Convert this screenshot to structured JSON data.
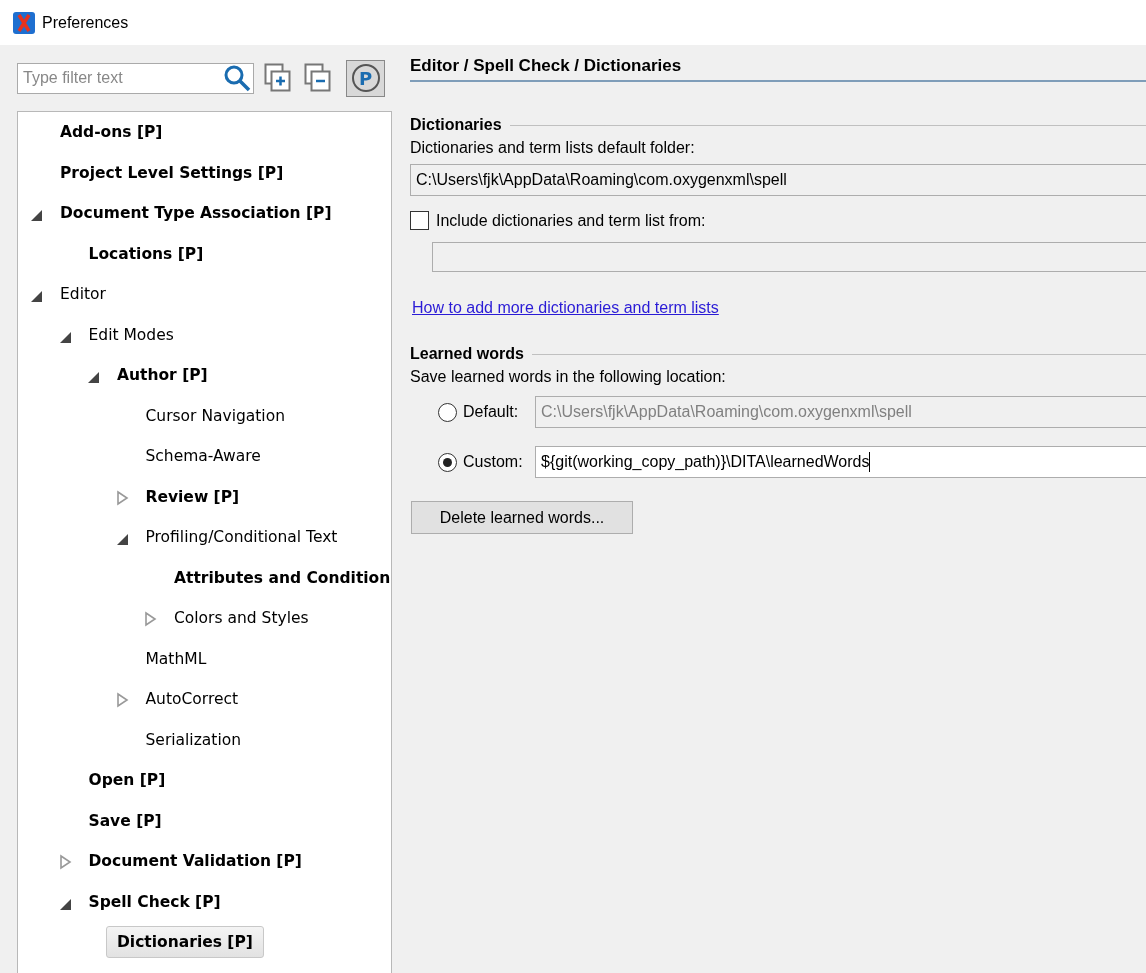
{
  "window": {
    "title": "Preferences"
  },
  "filter": {
    "placeholder": "Type filter text"
  },
  "toolbar": {
    "project_toggle": {
      "label": "P",
      "pressed": true
    }
  },
  "tree": [
    {
      "label": "Add-ons [P]",
      "bold": true,
      "selected": false
    },
    {
      "label": "Project Level Settings [P]",
      "bold": true,
      "selected": false
    },
    {
      "label": "Document Type Association [P]",
      "bold": true,
      "selected": false,
      "expanded": true,
      "children": [
        {
          "label": "Locations [P]",
          "bold": true,
          "selected": false
        }
      ]
    },
    {
      "label": "Editor",
      "bold": false,
      "selected": false,
      "expanded": true,
      "children": [
        {
          "label": "Edit Modes",
          "bold": false,
          "selected": false,
          "expanded": true,
          "children": [
            {
              "label": "Author [P]",
              "bold": true,
              "selected": false,
              "expanded": true,
              "children": [
                {
                  "label": "Cursor Navigation",
                  "bold": false,
                  "selected": false
                },
                {
                  "label": "Schema-Aware",
                  "bold": false,
                  "selected": false
                },
                {
                  "label": "Review [P]",
                  "bold": true,
                  "selected": false,
                  "expanded": false
                },
                {
                  "label": "Profiling/Conditional Text",
                  "bold": false,
                  "selected": false,
                  "expanded": true,
                  "children": [
                    {
                      "label": "Attributes and Condition",
                      "bold": true,
                      "selected": false
                    },
                    {
                      "label": "Colors and Styles",
                      "bold": false,
                      "selected": false,
                      "expanded": false
                    }
                  ]
                },
                {
                  "label": "MathML",
                  "bold": false,
                  "selected": false
                },
                {
                  "label": "AutoCorrect",
                  "bold": false,
                  "selected": false,
                  "expanded": false
                },
                {
                  "label": "Serialization",
                  "bold": false,
                  "selected": false
                }
              ]
            }
          ]
        },
        {
          "label": "Open [P]",
          "bold": true,
          "selected": false
        },
        {
          "label": "Save [P]",
          "bold": true,
          "selected": false
        },
        {
          "label": "Document Validation [P]",
          "bold": true,
          "selected": false,
          "expanded": false
        },
        {
          "label": "Spell Check [P]",
          "bold": true,
          "selected": false,
          "expanded": true,
          "children": [
            {
              "label": "Dictionaries [P]",
              "bold": true,
              "selected": true
            }
          ]
        }
      ]
    }
  ],
  "page": {
    "title": "Editor / Spell Check / Dictionaries",
    "dictionaries": {
      "heading": "Dictionaries",
      "folder_label": "Dictionaries and term lists default folder:",
      "folder_value": "C:\\Users\\fjk\\AppData\\Roaming\\com.oxygenxml\\spell",
      "include": {
        "label": "Include dictionaries and term list from:",
        "checked": false
      },
      "link": "How to add more dictionaries and term lists"
    },
    "learned": {
      "heading": "Learned words",
      "location_label": "Save learned words in the following location:",
      "options": [
        {
          "label": "Default:",
          "selected": false,
          "value": "C:\\Users\\fjk\\AppData\\Roaming\\com.oxygenxml\\spell"
        },
        {
          "label": "Custom:",
          "selected": true,
          "value": "${git(working_copy_path)}\\DITA\\learnedWords"
        }
      ],
      "delete_button": "Delete learned words..."
    }
  }
}
